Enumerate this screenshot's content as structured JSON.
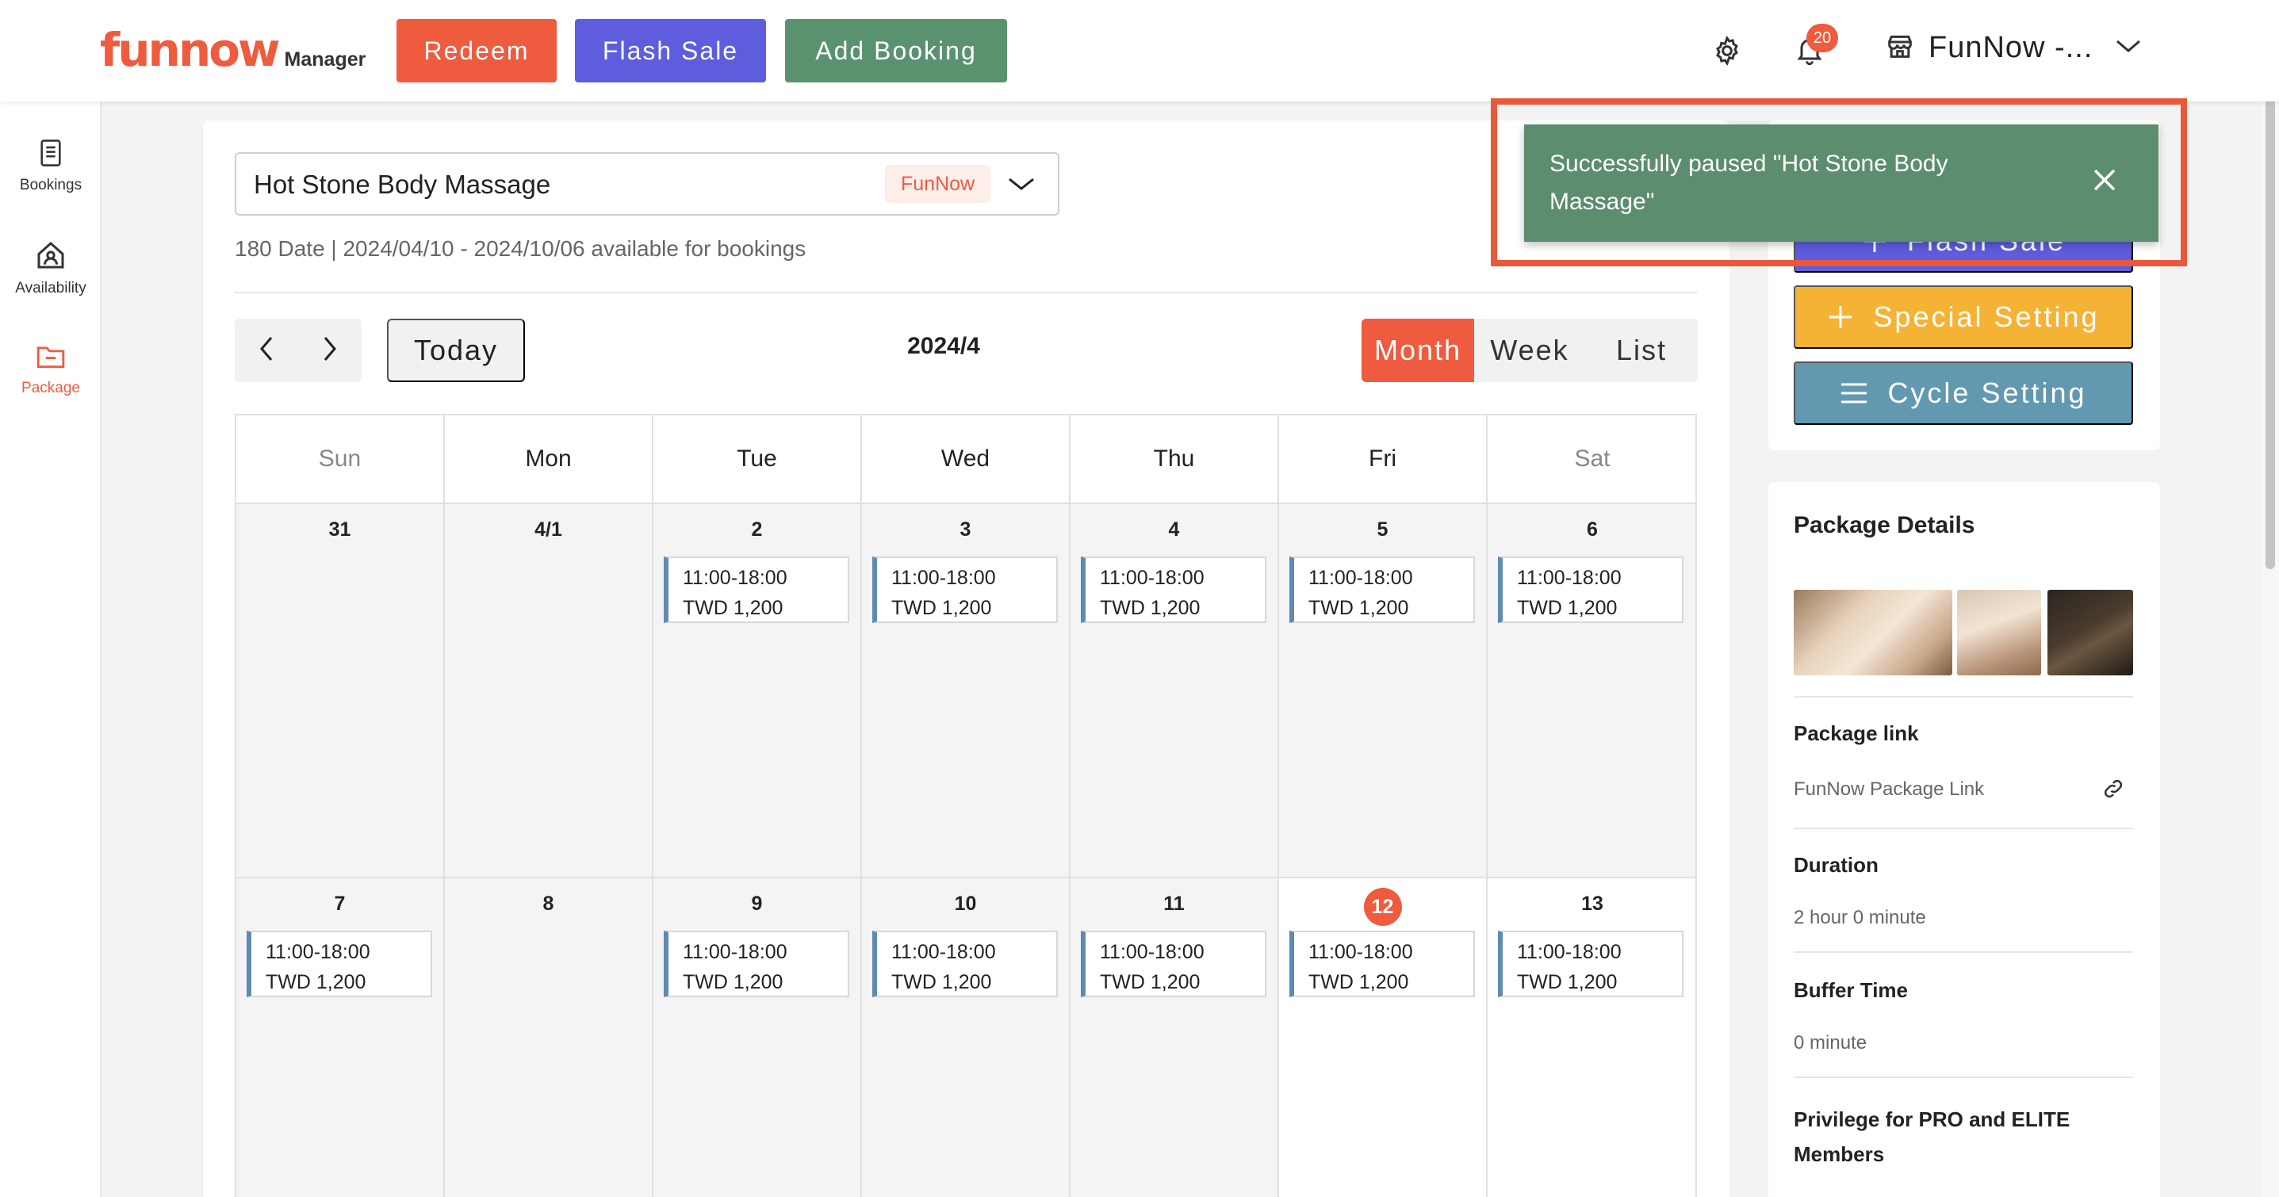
{
  "header": {
    "logo_main": "funnow",
    "logo_sub": "Manager",
    "redeem_label": "Redeem",
    "flash_sale_label": "Flash Sale",
    "add_booking_label": "Add Booking",
    "notification_count": "20",
    "store_name": "FunNow -...",
    "icons": [
      "gear-icon",
      "bell-icon",
      "store-icon",
      "chevron-down-icon"
    ]
  },
  "sidebar": {
    "items": [
      {
        "label": "Bookings",
        "icon": "document-icon"
      },
      {
        "label": "Availability",
        "icon": "home-user-icon"
      },
      {
        "label": "Package",
        "icon": "folder-icon",
        "active": true
      }
    ]
  },
  "package_selector": {
    "value": "Hot Stone Body Massage",
    "tag": "FunNow"
  },
  "availability_text": "180 Date | 2024/04/10 - 2024/10/06 available for bookings",
  "calendar": {
    "today_label": "Today",
    "title": "2024/4",
    "views": [
      "Month",
      "Week",
      "List"
    ],
    "active_view": "Month",
    "weekdays": [
      "Sun",
      "Mon",
      "Tue",
      "Wed",
      "Thu",
      "Fri",
      "Sat"
    ],
    "weeks": [
      [
        {
          "day": "31",
          "slots": []
        },
        {
          "day": "4/1",
          "slots": []
        },
        {
          "day": "2",
          "slots": [
            {
              "time": "11:00-18:00",
              "price": "TWD 1,200"
            }
          ]
        },
        {
          "day": "3",
          "slots": [
            {
              "time": "11:00-18:00",
              "price": "TWD 1,200"
            }
          ]
        },
        {
          "day": "4",
          "slots": [
            {
              "time": "11:00-18:00",
              "price": "TWD 1,200"
            }
          ]
        },
        {
          "day": "5",
          "slots": [
            {
              "time": "11:00-18:00",
              "price": "TWD 1,200"
            }
          ]
        },
        {
          "day": "6",
          "slots": [
            {
              "time": "11:00-18:00",
              "price": "TWD 1,200"
            }
          ]
        }
      ],
      [
        {
          "day": "7",
          "slots": [
            {
              "time": "11:00-18:00",
              "price": "TWD 1,200"
            }
          ]
        },
        {
          "day": "8",
          "slots": []
        },
        {
          "day": "9",
          "slots": [
            {
              "time": "11:00-18:00",
              "price": "TWD 1,200"
            }
          ]
        },
        {
          "day": "10",
          "slots": [
            {
              "time": "11:00-18:00",
              "price": "TWD 1,200"
            }
          ]
        },
        {
          "day": "11",
          "slots": [
            {
              "time": "11:00-18:00",
              "price": "TWD 1,200"
            }
          ]
        },
        {
          "day": "12",
          "today": true,
          "slots": [
            {
              "time": "11:00-18:00",
              "price": "TWD 1,200"
            }
          ]
        },
        {
          "day": "13",
          "slots": [
            {
              "time": "11:00-18:00",
              "price": "TWD 1,200"
            }
          ]
        }
      ]
    ]
  },
  "actions": {
    "flash_sale_label": "Flash Sale",
    "special_setting_label": "Special Setting",
    "cycle_setting_label": "Cycle Setting"
  },
  "package_details": {
    "title": "Package Details",
    "link_label": "Package link",
    "link_text": "FunNow Package Link",
    "duration_label": "Duration",
    "duration_value": "2 hour 0 minute",
    "buffer_label": "Buffer Time",
    "buffer_value": "0 minute",
    "privilege_label": "Privilege for PRO and ELITE Members"
  },
  "toast": {
    "message": "Successfully paused \"Hot Stone Body Massage\""
  },
  "colors": {
    "brand": "#ee5b3e",
    "flash_sale": "#5d5ddd",
    "add_booking": "#5a9270",
    "special_setting": "#f5b335",
    "cycle_setting": "#6399b0",
    "toast_bg": "#5b8d6e",
    "slot_accent": "#5f8ab3"
  }
}
